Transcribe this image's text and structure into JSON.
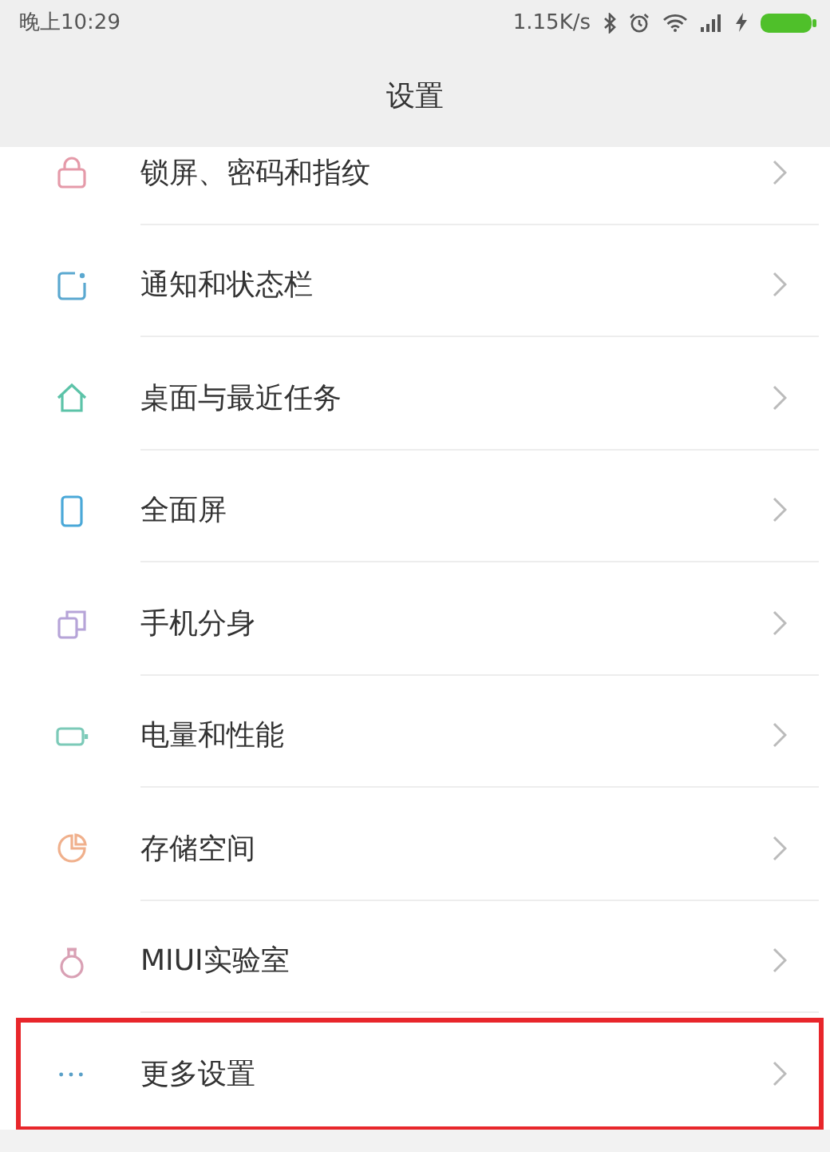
{
  "status_bar": {
    "time": "晚上10:29",
    "speed": "1.15K/s"
  },
  "header": {
    "title": "设置"
  },
  "items": [
    {
      "label": "锁屏、密码和指纹",
      "kind": "lock",
      "highlighted": false
    },
    {
      "label": "通知和状态栏",
      "kind": "notification",
      "highlighted": false
    },
    {
      "label": "桌面与最近任务",
      "kind": "home",
      "highlighted": false
    },
    {
      "label": "全面屏",
      "kind": "screen",
      "highlighted": false
    },
    {
      "label": "手机分身",
      "kind": "dual",
      "highlighted": false
    },
    {
      "label": "电量和性能",
      "kind": "battery",
      "highlighted": false
    },
    {
      "label": "存储空间",
      "kind": "storage",
      "highlighted": false
    },
    {
      "label": "MIUI实验室",
      "kind": "lab",
      "highlighted": false
    },
    {
      "label": "更多设置",
      "kind": "more",
      "highlighted": true
    }
  ]
}
